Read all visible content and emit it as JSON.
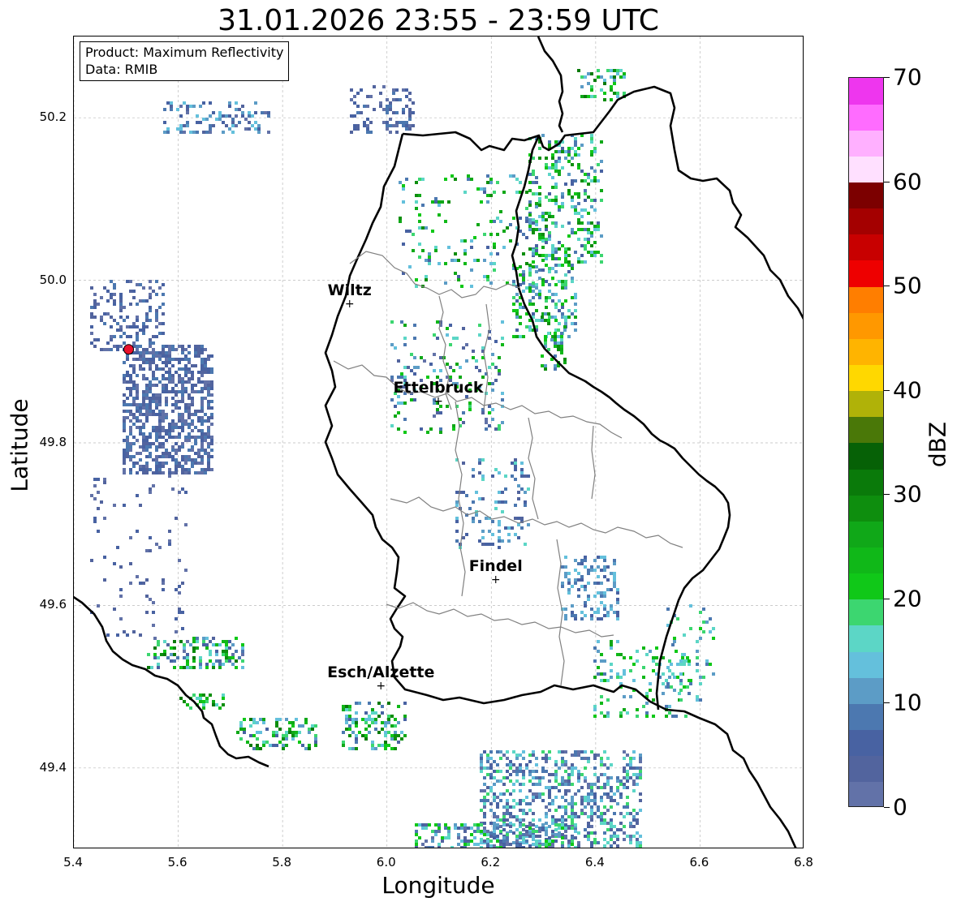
{
  "title": "31.01.2026 23:55 - 23:59 UTC",
  "info": {
    "product": "Product: Maximum Reflectivity",
    "data": "Data: RMIB"
  },
  "axes": {
    "xlabel": "Longitude",
    "ylabel": "Latitude",
    "xlim": [
      5.4,
      6.8
    ],
    "ylim": [
      49.3,
      50.3
    ],
    "xticks": [
      "5.4",
      "5.6",
      "5.8",
      "6.0",
      "6.2",
      "6.4",
      "6.6",
      "6.8"
    ],
    "yticks": [
      "49.4",
      "49.6",
      "49.8",
      "50.0",
      "50.2"
    ],
    "grid": true
  },
  "colorbar": {
    "label": "dBZ",
    "range": [
      0,
      70
    ],
    "ticks": [
      "0",
      "10",
      "20",
      "30",
      "40",
      "50",
      "60",
      "70"
    ],
    "colors": [
      "#6272a8",
      "#52649e",
      "#4862a2",
      "#4c78b0",
      "#5c9cc6",
      "#64c0dc",
      "#5cd6c6",
      "#3cd670",
      "#10c818",
      "#10b818",
      "#10a818",
      "#0e8e0e",
      "#0a7a0a",
      "#066106",
      "#4a7808",
      "#b0b208",
      "#ffd800",
      "#ffb400",
      "#ff9800",
      "#ff7e00",
      "#ee0000",
      "#c80000",
      "#a40000",
      "#7c0000",
      "#ffe0ff",
      "#ffb0ff",
      "#ff6cff",
      "#ee36ee"
    ]
  },
  "cities": [
    {
      "name": "Wiltz",
      "lon": 5.93,
      "lat": 49.97
    },
    {
      "name": "Ettelbruck",
      "lon": 6.1,
      "lat": 49.85
    },
    {
      "name": "Findel",
      "lon": 6.21,
      "lat": 49.63
    },
    {
      "name": "Esch/Alzette",
      "lon": 5.99,
      "lat": 49.5
    }
  ],
  "radar_site": {
    "lon": 5.505,
    "lat": 49.915
  },
  "icons": {
    "city_marker": "plus-icon",
    "radar_marker": "red-dot-icon"
  }
}
